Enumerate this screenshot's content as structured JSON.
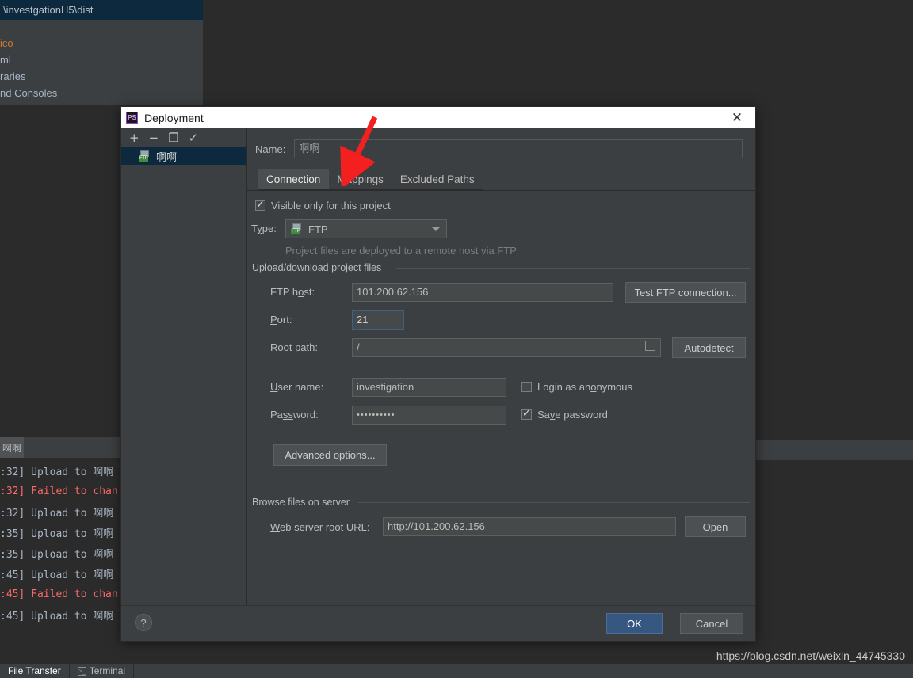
{
  "ide": {
    "project_panel": {
      "header": "\\investgationH5\\dist",
      "items": [
        "ico",
        "ml",
        "raries",
        "nd Consoles"
      ]
    },
    "file_transfer": {
      "tab_label": "啊啊",
      "lines": [
        {
          "text": ":32] Upload to 啊啊",
          "type": "ok"
        },
        {
          "text": ":32] Failed to chan",
          "type": "err"
        },
        {
          "text": ":32] Upload to 啊啊",
          "type": "ok"
        },
        {
          "text": ":35] Upload to 啊啊",
          "type": "ok"
        },
        {
          "text": ":35] Upload to 啊啊",
          "type": "ok"
        },
        {
          "text": ":45] Upload to 啊啊",
          "type": "ok"
        },
        {
          "text": ":45] Failed to chan",
          "type": "err"
        },
        {
          "text": ":45] Upload to 啊啊",
          "type": "ok"
        }
      ]
    },
    "statusbar": {
      "file_transfer_tab": "File Transfer",
      "terminal_tab": "Terminal"
    },
    "watermark": "https://blog.csdn.net/weixin_44745330"
  },
  "dialog": {
    "title": "Deployment",
    "app_icon": "PS",
    "close_label": "✕",
    "toolbar": {
      "add": "+",
      "remove": "−",
      "copy": "❐",
      "check": "✓"
    },
    "servers": [
      {
        "label": "啊啊",
        "protocol": "FTP",
        "selected": true
      }
    ],
    "name": {
      "label_pre": "Na",
      "label_mnemonic": "m",
      "label_post": "e:",
      "value": "啊啊"
    },
    "tabs": [
      {
        "label": "Connection",
        "active": true
      },
      {
        "label": "Mappings",
        "active": false
      },
      {
        "label": "Excluded Paths",
        "active": false
      }
    ],
    "connection": {
      "visible_only_checkbox": {
        "label": "Visible only for this project",
        "checked": true
      },
      "type": {
        "label_pre": "T",
        "label_mnemonic": "y",
        "label_post": "pe:",
        "value": "FTP",
        "badge": "FTP"
      },
      "type_hint": "Project files are deployed to a remote host via FTP",
      "upload_group_title": "Upload/download project files",
      "ftp_host": {
        "label_pre": "FTP h",
        "label_mnemonic": "o",
        "label_post": "st:",
        "value": "101.200.62.156"
      },
      "test_connection_button": "Test FTP connection...",
      "port": {
        "label_pre": "",
        "label_mnemonic": "P",
        "label_post": "ort:",
        "value": "21",
        "focused": true
      },
      "root_path": {
        "label_pre": "",
        "label_mnemonic": "R",
        "label_post": "oot path:",
        "value": "/"
      },
      "autodetect_button": "Autodetect",
      "user_name": {
        "label_pre": "",
        "label_mnemonic": "U",
        "label_post": "ser name:",
        "value": "investigation"
      },
      "login_anonymous": {
        "label_pre": "Login as an",
        "label_mnemonic": "o",
        "label_post": "nymous",
        "checked": false
      },
      "password": {
        "label_pre": "Pa",
        "label_mnemonic": "ss",
        "label_post": "word:",
        "value": "••••••••••"
      },
      "save_password": {
        "label_pre": "Sa",
        "label_mnemonic": "v",
        "label_post": "e password",
        "checked": true
      },
      "advanced_options_button": "Advanced options...",
      "browse_group_title": "Browse files on server",
      "web_server_root_url": {
        "label_pre": "",
        "label_mnemonic": "W",
        "label_post": "eb server root URL:",
        "value": "http://101.200.62.156"
      },
      "open_button": "Open"
    },
    "footer": {
      "help": "?",
      "ok": "OK",
      "cancel": "Cancel"
    }
  },
  "annotation": {
    "arrow_color": "#f42020"
  }
}
